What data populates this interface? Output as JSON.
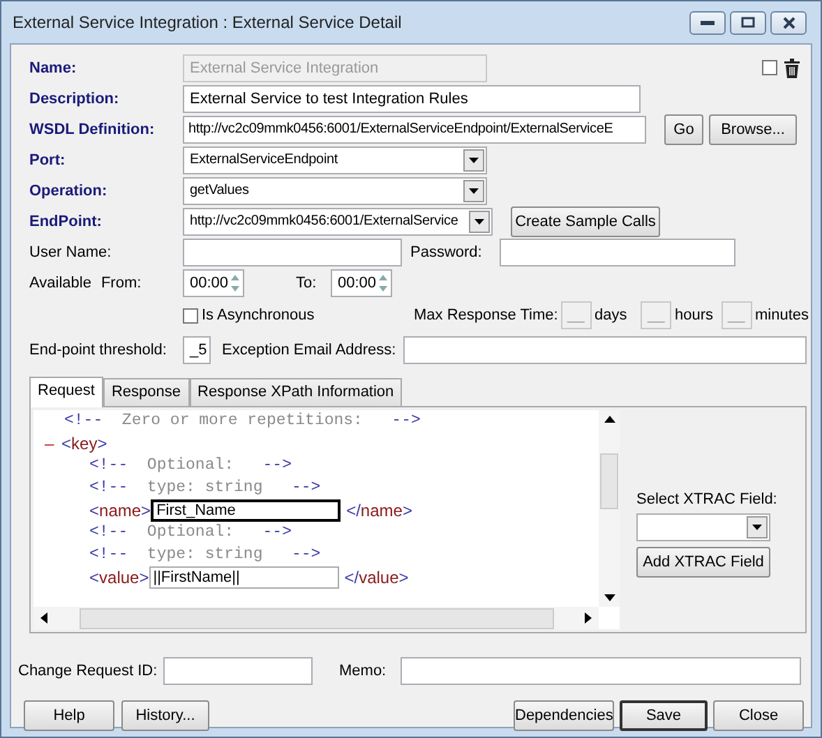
{
  "window": {
    "title": "External Service Integration : External Service Detail"
  },
  "select_checkbox": {
    "checked": false
  },
  "name": {
    "label": "Name:",
    "value": "External Service Integration",
    "disabled": true
  },
  "description": {
    "label": "Description:",
    "value": "External Service to test Integration Rules"
  },
  "wsdl": {
    "label": "WSDL Definition:",
    "value": "http://vc2c09mmk0456:6001/ExternalServiceEndpoint/ExternalServiceE",
    "buttons": [
      "Go",
      "Browse..."
    ]
  },
  "port": {
    "label": "Port:",
    "value": "ExternalServiceEndpoint"
  },
  "operation": {
    "label": "Operation:",
    "value": "getValues"
  },
  "endpoint": {
    "label": "EndPoint:",
    "value": "http://vc2c09mmk0456:6001/ExternalService",
    "button": "Create Sample Calls"
  },
  "user_name": {
    "label": "User Name:"
  },
  "password": {
    "label": "Password:"
  },
  "available": {
    "label": "Available",
    "from_label": "From:",
    "from": "00:00",
    "to_label": "To:",
    "to": "00:00"
  },
  "asynchronous": {
    "label": "Is Asynchronous",
    "checked": false
  },
  "max_response": {
    "label": "Max Response Time:",
    "units": [
      {
        "value": "__",
        "unit": "days"
      },
      {
        "value": "__",
        "unit": "hours"
      },
      {
        "value": "__",
        "unit": "minutes"
      }
    ]
  },
  "threshold": {
    "label": "End-point threshold:",
    "value": "_5"
  },
  "exception_email": {
    "label": "Exception Email Address:"
  },
  "tabs": [
    {
      "label": "Request",
      "selected": true
    },
    {
      "label": "Response",
      "selected": false
    },
    {
      "label": "Response XPath Information",
      "selected": false
    }
  ],
  "xml": [
    {
      "kind": "comment",
      "open": "<!--",
      "text": "Zero or more repetitions:",
      "close": "-->"
    },
    {
      "kind": "element",
      "toggle": "–",
      "open_tag": "<key>",
      "expanded": true,
      "children": [
        {
          "kind": "comment",
          "open": "<!--",
          "text": "Optional:",
          "close": "-->"
        },
        {
          "kind": "comment",
          "open": "<!--",
          "text": "type: string",
          "close": "-->"
        },
        {
          "kind": "field",
          "open_tag": "<name>",
          "value": "First_Name",
          "close_tag": "</name>",
          "focused": true
        },
        {
          "kind": "comment",
          "open": "<!--",
          "text": "Optional:",
          "close": "-->"
        },
        {
          "kind": "comment",
          "open": "<!--",
          "text": "type: string",
          "close": "-->"
        },
        {
          "kind": "field",
          "open_tag": "<value>",
          "value": "||FirstName||",
          "close_tag": "</value>",
          "focused": false
        }
      ]
    }
  ],
  "xtrac": {
    "label": "Select XTRAC Field:",
    "button": "Add XTRAC Field"
  },
  "change_request": {
    "label": "Change Request ID:"
  },
  "memo": {
    "label": "Memo:"
  },
  "footer_buttons": [
    {
      "label": "Help",
      "kind": "left",
      "default": false
    },
    {
      "label": "History...",
      "kind": "left",
      "default": false
    },
    {
      "label": "Dependencies",
      "kind": "right",
      "default": false
    },
    {
      "label": "Save",
      "kind": "right",
      "default": true
    },
    {
      "label": "Close",
      "kind": "right",
      "default": false
    }
  ]
}
